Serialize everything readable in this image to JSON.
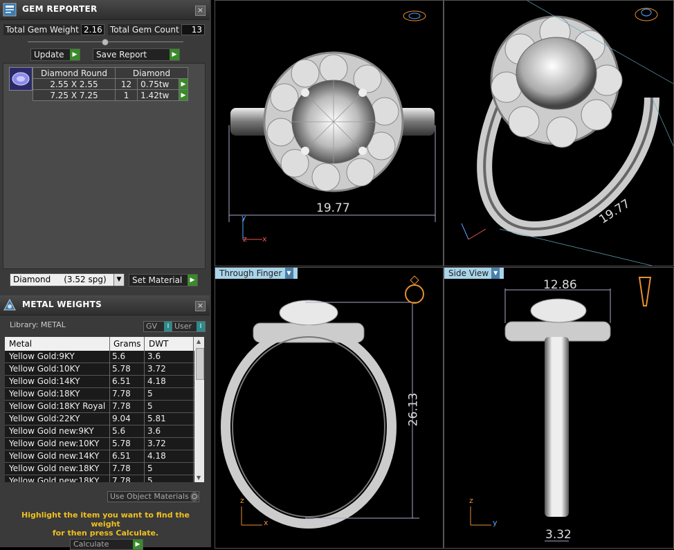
{
  "gem_reporter": {
    "title": "GEM REPORTER",
    "total_weight_label": "Total Gem Weight",
    "total_weight_value": "2.16",
    "total_count_label": "Total Gem Count",
    "total_count_value": "13",
    "update_label": "Update",
    "save_label": "Save Report",
    "table": {
      "header": [
        "Diamond Round",
        "Diamond"
      ],
      "rows": [
        {
          "size": "2.55 X 2.55",
          "count": "12",
          "weight": "0.75tw"
        },
        {
          "size": "7.25 X 7.25",
          "count": "1",
          "weight": "1.42tw"
        }
      ]
    },
    "material_select": "Diamond     (3.52 spg)",
    "set_material_label": "Set Material"
  },
  "metal_weights": {
    "title": "METAL WEIGHTS",
    "library_label": "Library: METAL",
    "gv_label": "GV",
    "user_label": "User",
    "columns": [
      "Metal",
      "Grams",
      "DWT"
    ],
    "rows": [
      {
        "metal": "Yellow Gold:9KY",
        "grams": "5.6",
        "dwt": "3.6"
      },
      {
        "metal": "Yellow Gold:10KY",
        "grams": "5.78",
        "dwt": "3.72"
      },
      {
        "metal": "Yellow Gold:14KY",
        "grams": "6.51",
        "dwt": "4.18"
      },
      {
        "metal": "Yellow Gold:18KY",
        "grams": "7.78",
        "dwt": "5"
      },
      {
        "metal": "Yellow Gold:18KY Royal",
        "grams": "7.78",
        "dwt": "5"
      },
      {
        "metal": "Yellow Gold:22KY",
        "grams": "9.04",
        "dwt": "5.81"
      },
      {
        "metal": "Yellow Gold new:9KY",
        "grams": "5.6",
        "dwt": "3.6"
      },
      {
        "metal": "Yellow Gold new:10KY",
        "grams": "5.78",
        "dwt": "3.72"
      },
      {
        "metal": "Yellow Gold new:14KY",
        "grams": "6.51",
        "dwt": "4.18"
      },
      {
        "metal": "Yellow Gold new:18KY",
        "grams": "7.78",
        "dwt": "5"
      },
      {
        "metal": "Yellow Gold new:18KY...",
        "grams": "7.78",
        "dwt": "5"
      }
    ],
    "use_object_materials": "Use Object Materials",
    "hint_line1": "Highlight the item you want to find the weight",
    "hint_line2": "for then press Calculate.",
    "calculate_label": "Calculate"
  },
  "viewports": {
    "top_dim": "19.77",
    "persp_dim": "19.77",
    "front_label": "Through Finger",
    "front_dim": "26.13",
    "side_label": "Side View",
    "side_dim_top": "12.86",
    "side_dim_bottom": "3.32",
    "axis_y": "y",
    "axis_x": "x",
    "axis_z": "z"
  }
}
